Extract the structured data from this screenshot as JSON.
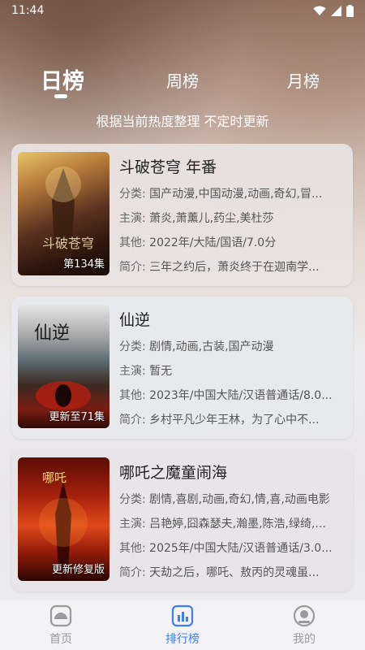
{
  "status": {
    "time": "11:44"
  },
  "tabs": [
    {
      "label": "日榜",
      "active": true
    },
    {
      "label": "周榜",
      "active": false
    },
    {
      "label": "月榜",
      "active": false
    }
  ],
  "subtitle": "根据当前热度整理 不定时更新",
  "items": [
    {
      "title": "斗破苍穹 年番",
      "poster_tag": "第134集",
      "category_label": "分类:",
      "category": "国产动漫,中国动漫,动画,奇幻,冒...",
      "cast_label": "主演:",
      "cast": "萧炎,萧薰儿,药尘,美杜莎",
      "other_label": "其他:",
      "other": "2022年/大陆/国语/7.0分",
      "intro_label": "简介:",
      "intro": "三年之约后，萧炎终于在迦南学..."
    },
    {
      "title": "仙逆",
      "poster_tag": "更新至71集",
      "category_label": "分类:",
      "category": "剧情,动画,古装,国产动漫",
      "cast_label": "主演:",
      "cast": "暂无",
      "other_label": "其他:",
      "other": "2023年/中国大陆/汉语普通话/8.0...",
      "intro_label": "简介:",
      "intro": "乡村平凡少年王林，为了心中不..."
    },
    {
      "title": "哪吒之魔童闹海",
      "poster_tag": "更新修复版",
      "category_label": "分类:",
      "category": "剧情,喜剧,动画,奇幻,情,喜,动画电影",
      "cast_label": "主演:",
      "cast": "吕艳婷,囧森瑟夫,瀚墨,陈浩,绿绮,...",
      "other_label": "其他:",
      "other": "2025年/中国大陆/汉语普通话/3.0...",
      "intro_label": "简介:",
      "intro": "天劫之后，哪吒、敖丙的灵魂虽..."
    }
  ],
  "nav": [
    {
      "label": "首页",
      "icon": "home-icon",
      "active": false
    },
    {
      "label": "排行榜",
      "icon": "ranking-icon",
      "active": true
    },
    {
      "label": "我的",
      "icon": "profile-icon",
      "active": false
    }
  ],
  "colors": {
    "accent": "#3f7ef2",
    "inactive": "#9a9a9a"
  }
}
